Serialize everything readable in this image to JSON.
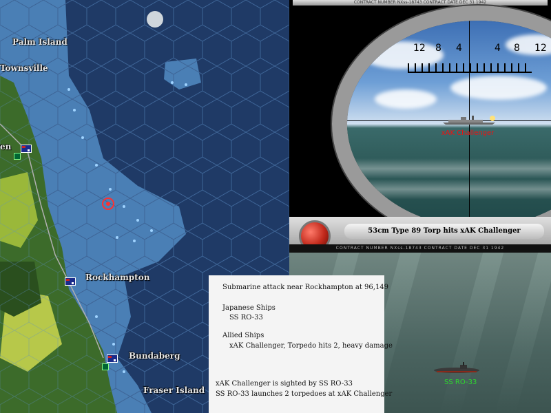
{
  "map": {
    "towns": {
      "palm_island": "Palm Island",
      "townsville": "Townsville",
      "partial_left": "en",
      "rockhampton": "Rockhampton",
      "bundaberg": "Bundaberg",
      "fraser_island": "Fraser Island"
    }
  },
  "periscope": {
    "strip_text": "CONTRACT NUMBER NXss-18743     CONTRACT DATE DEC 31 1942",
    "range_ticks": [
      "12",
      "8",
      "4",
      "4",
      "8",
      "12"
    ],
    "target_label": "xAK Challenger"
  },
  "message_bar": {
    "message": "53cm Type 89 Torp hits xAK Challenger",
    "strip_text": "CONTRACT NUMBER   NXss-18743          CONTRACT DATE   DEC 31 1942"
  },
  "underwater": {
    "sub_label": "SS RO-33"
  },
  "report": {
    "headline": "Submarine attack near Rockhampton  at 96,149",
    "japanese_header": "Japanese Ships",
    "japanese_ship": "SS RO-33",
    "allied_header": "Allied Ships",
    "allied_ship": "xAK Challenger, Torpedo hits 2,  heavy damage",
    "log_1": "xAK Challenger is sighted by SS RO-33",
    "log_2": "SS RO-33 launches 2 torpedoes at xAK Challenger"
  },
  "colors": {
    "deep_sea": "#1f3a66",
    "shallow_sea": "#4a7fb5",
    "land": "#3c6b2a",
    "target_label": "#ee1111",
    "sub_label": "#2ed82e"
  }
}
